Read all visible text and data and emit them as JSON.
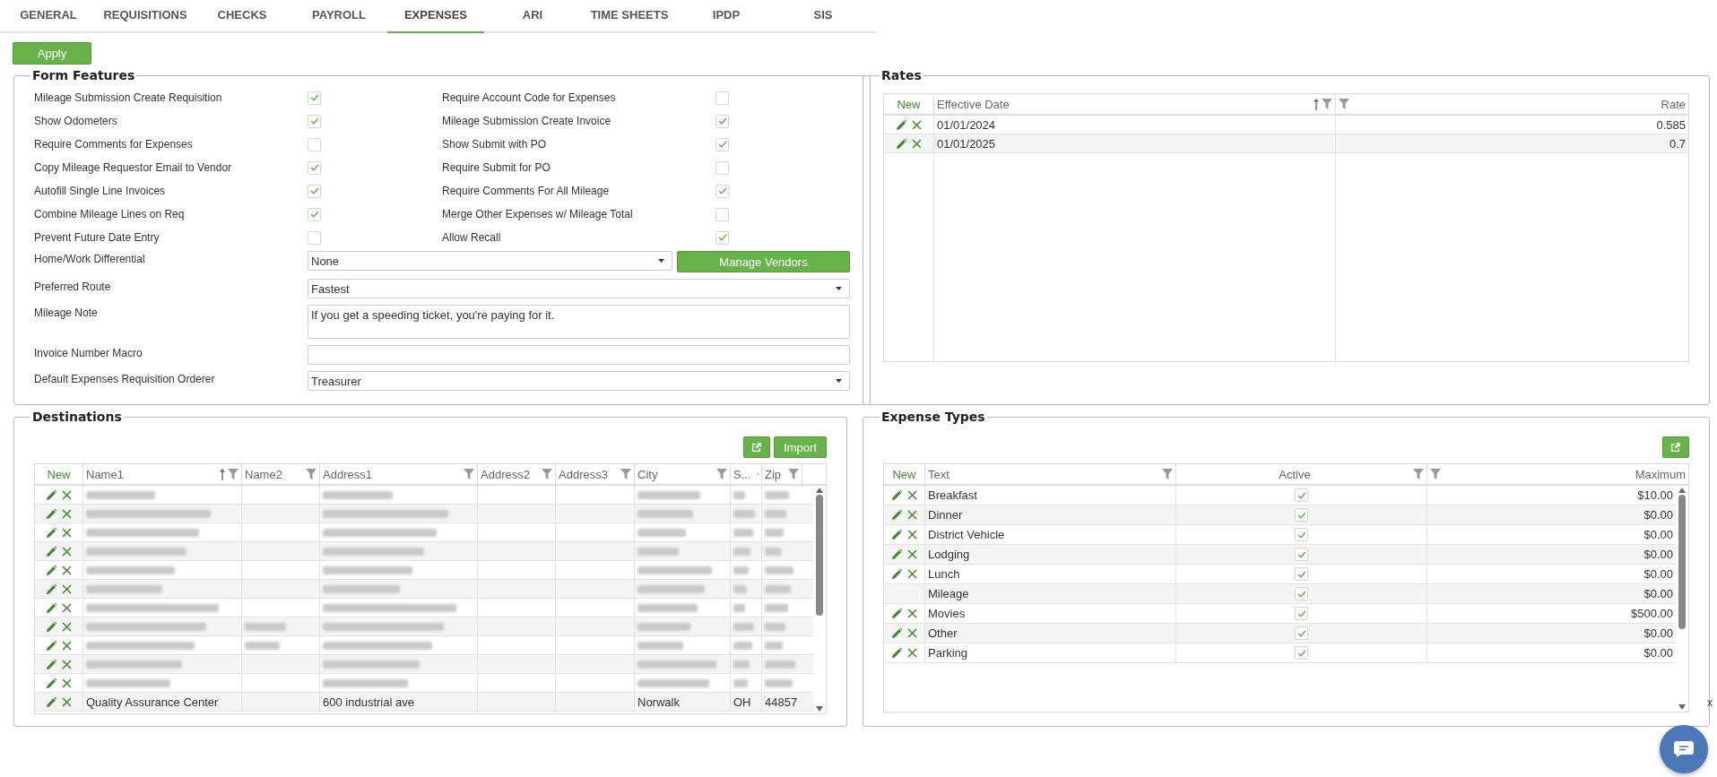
{
  "tabs": [
    {
      "label": "GENERAL",
      "selected": false
    },
    {
      "label": "REQUISITIONS",
      "selected": false
    },
    {
      "label": "CHECKS",
      "selected": false
    },
    {
      "label": "PAYROLL",
      "selected": false
    },
    {
      "label": "EXPENSES",
      "selected": true
    },
    {
      "label": "ARI",
      "selected": false
    },
    {
      "label": "TIME SHEETS",
      "selected": false
    },
    {
      "label": "IPDP",
      "selected": false
    },
    {
      "label": "SIS",
      "selected": false
    }
  ],
  "apply_button": "Apply",
  "form_features": {
    "title": "Form Features",
    "options": [
      {
        "label": "Mileage Submission Create Requisition",
        "checked": true
      },
      {
        "label": "Require Account Code for Expenses",
        "checked": false
      },
      {
        "label": "Show Odometers",
        "checked": true
      },
      {
        "label": "Mileage Submission Create Invoice",
        "checked": true
      },
      {
        "label": "Require Comments for Expenses",
        "checked": false
      },
      {
        "label": "Show Submit with PO",
        "checked": true
      },
      {
        "label": "Copy Mileage Requestor Email to Vendor",
        "checked": true
      },
      {
        "label": "Require Submit for PO",
        "checked": false
      },
      {
        "label": "Autofill Single Line Invoices",
        "checked": true
      },
      {
        "label": "Require Comments For All Mileage",
        "checked": true
      },
      {
        "label": "Combine Mileage Lines on Req",
        "checked": true
      },
      {
        "label": "Merge Other Expenses w/ Mileage Total",
        "checked": false
      },
      {
        "label": "Prevent Future Date Entry",
        "checked": false
      },
      {
        "label": "Allow Recall",
        "checked": true
      }
    ],
    "fields": [
      {
        "label": "Home/Work Differential",
        "kind": "select",
        "value": "None",
        "button": "Manage Vendors"
      },
      {
        "label": "Preferred Route",
        "kind": "select",
        "value": "Fastest"
      },
      {
        "label": "Mileage Note",
        "kind": "textarea",
        "value": "If you get a speeding ticket, you're paying for it."
      },
      {
        "label": "Invoice Number Macro",
        "kind": "text"
      },
      {
        "label": "Default Expenses Requisition Orderer",
        "kind": "select",
        "value": "Treasurer"
      }
    ]
  },
  "rates": {
    "title": "Rates",
    "new_label": "New",
    "columns": [
      {
        "label": "Effective Date",
        "sorted": true
      },
      {
        "label": "Rate",
        "sorted": false
      }
    ],
    "rows": [
      {
        "cells": [
          "01/01/2024",
          "0.585"
        ]
      },
      {
        "cells": [
          "01/01/2025",
          "0.7"
        ]
      }
    ]
  },
  "destinations": {
    "title": "Destinations",
    "import_button": "Import",
    "new_label": "New",
    "columns": [
      {
        "label": "Name1",
        "sorted": true
      },
      {
        "label": "Name2",
        "sorted": false
      },
      {
        "label": "Address1",
        "sorted": false
      },
      {
        "label": "Address2",
        "sorted": false
      },
      {
        "label": "Address3",
        "sorted": false
      },
      {
        "label": "City",
        "sorted": false
      },
      {
        "label": "S...",
        "sorted": false
      },
      {
        "label": "Zip",
        "sorted": false
      }
    ],
    "rows": [
      {
        "kind": "blurred",
        "filled": [
          true,
          false,
          true,
          false,
          false,
          true,
          true,
          true
        ]
      },
      {
        "kind": "blurred",
        "filled": [
          true,
          false,
          true,
          false,
          false,
          true,
          true,
          true
        ]
      },
      {
        "kind": "blurred",
        "filled": [
          true,
          false,
          true,
          false,
          false,
          true,
          true,
          true
        ]
      },
      {
        "kind": "blurred",
        "filled": [
          true,
          false,
          true,
          false,
          false,
          true,
          true,
          true
        ]
      },
      {
        "kind": "blurred",
        "filled": [
          true,
          false,
          true,
          false,
          false,
          true,
          true,
          true
        ]
      },
      {
        "kind": "blurred",
        "filled": [
          true,
          false,
          true,
          false,
          false,
          true,
          true,
          true
        ]
      },
      {
        "kind": "blurred",
        "filled": [
          true,
          false,
          true,
          false,
          false,
          true,
          true,
          true
        ]
      },
      {
        "kind": "blurred",
        "filled": [
          true,
          true,
          true,
          false,
          false,
          true,
          true,
          true
        ]
      },
      {
        "kind": "blurred",
        "filled": [
          true,
          true,
          true,
          false,
          false,
          true,
          true,
          true
        ]
      },
      {
        "kind": "blurred",
        "filled": [
          true,
          false,
          true,
          false,
          false,
          true,
          true,
          true
        ]
      },
      {
        "kind": "blurred",
        "filled": [
          true,
          false,
          true,
          false,
          false,
          true,
          true,
          true
        ]
      },
      {
        "kind": "text",
        "cells": [
          "Quality Assurance Center",
          "",
          "600 industrial ave",
          "",
          "",
          "Norwalk",
          "OH",
          "44857"
        ]
      }
    ]
  },
  "expense_types": {
    "title": "Expense Types",
    "new_label": "New",
    "columns": [
      {
        "label": "Text"
      },
      {
        "label": "Active"
      },
      {
        "label": "Maximum"
      }
    ],
    "rows": [
      {
        "text": "Breakfast",
        "active": true,
        "maximum": "$10.00",
        "editable": true
      },
      {
        "text": "Dinner",
        "active": true,
        "maximum": "$0.00",
        "editable": true
      },
      {
        "text": "District Vehicle",
        "active": true,
        "maximum": "$0.00",
        "editable": true
      },
      {
        "text": "Lodging",
        "active": true,
        "maximum": "$0.00",
        "editable": true
      },
      {
        "text": "Lunch",
        "active": true,
        "maximum": "$0.00",
        "editable": true
      },
      {
        "text": "Mileage",
        "active": true,
        "maximum": "$0.00",
        "editable": false
      },
      {
        "text": "Movies",
        "active": true,
        "maximum": "$500.00",
        "editable": true
      },
      {
        "text": "Other",
        "active": true,
        "maximum": "$0.00",
        "editable": true
      },
      {
        "text": "Parking",
        "active": true,
        "maximum": "$0.00",
        "editable": true
      }
    ]
  },
  "chat_close": "x"
}
